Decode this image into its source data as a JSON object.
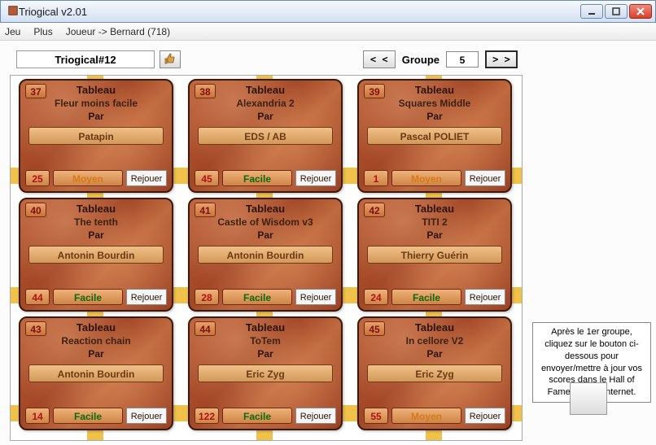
{
  "window": {
    "title": "Triogical v2.01"
  },
  "menu": {
    "jeu": "Jeu",
    "plus": "Plus",
    "joueur": "Joueur -> Bernard (718)"
  },
  "top": {
    "sequence_name": "Triogical#12",
    "prev_symbol": "< <",
    "next_symbol": "> >",
    "group_label": "Groupe",
    "group_number": "5"
  },
  "labels": {
    "tableau": "Tableau",
    "par": "Par",
    "replay": "Rejouer"
  },
  "cards": [
    {
      "num": "37",
      "title": "Fleur moins facile",
      "author": "Patapin",
      "score": "25",
      "diff": "Moyen"
    },
    {
      "num": "38",
      "title": "Alexandria 2",
      "author": "EDS / AB",
      "score": "45",
      "diff": "Facile"
    },
    {
      "num": "39",
      "title": "Squares Middle",
      "author": "Pascal POLIET",
      "score": "1",
      "diff": "Moyen"
    },
    {
      "num": "40",
      "title": "The tenth",
      "author": "Antonin Bourdin",
      "score": "44",
      "diff": "Facile"
    },
    {
      "num": "41",
      "title": "Castle of Wisdom v3",
      "author": "Antonin Bourdin",
      "score": "28",
      "diff": "Facile"
    },
    {
      "num": "42",
      "title": "TITI 2",
      "author": "Thierry Guérin",
      "score": "24",
      "diff": "Facile"
    },
    {
      "num": "43",
      "title": "Reaction chain",
      "author": "Antonin Bourdin",
      "score": "14",
      "diff": "Facile"
    },
    {
      "num": "44",
      "title": "ToTem",
      "author": "Eric Zyg",
      "score": "122",
      "diff": "Facile"
    },
    {
      "num": "45",
      "title": "In cellore V2",
      "author": "Eric Zyg",
      "score": "55",
      "diff": "Moyen"
    }
  ],
  "side": {
    "hint": "Après le 1er groupe, cliquez sur le bouton ci-dessous pour envoyer/mettre à jour vos scores dans le Hall of Fame du Site Internet."
  }
}
